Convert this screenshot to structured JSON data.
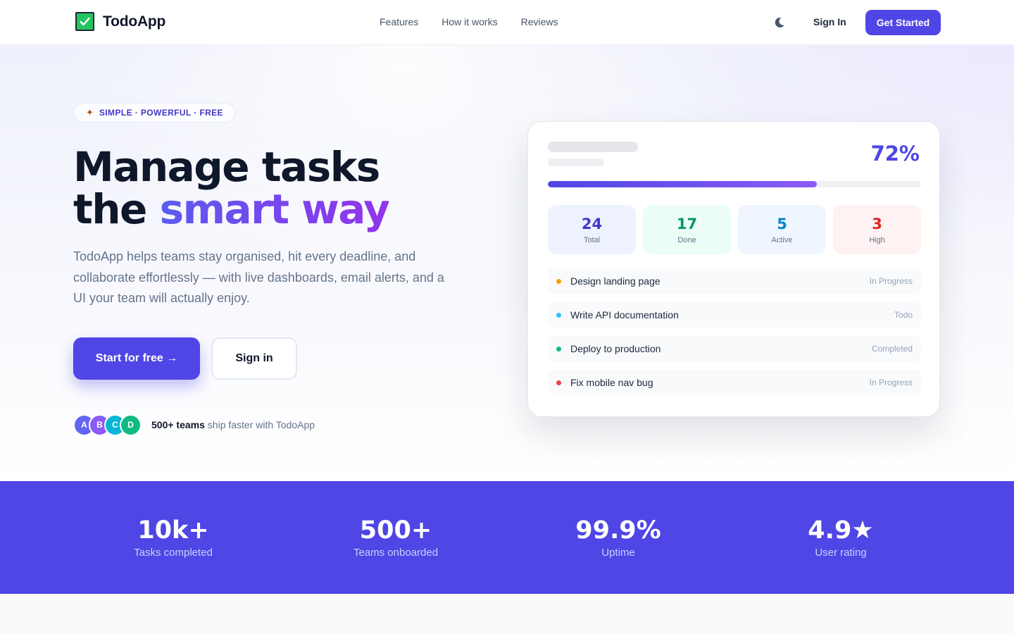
{
  "nav": {
    "brand": "TodoApp",
    "links": [
      "Features",
      "How it works",
      "Reviews"
    ],
    "theme_icon": "moon-icon",
    "sign_in": "Sign In",
    "get_started": "Get Started"
  },
  "hero": {
    "badge_icon": "sparkle-icon",
    "badge": "SIMPLE · POWERFUL · FREE",
    "headline_line1": "Manage tasks",
    "headline_word": "the",
    "headline_gradient": "smart way",
    "subtext": "TodoApp helps teams stay organised, hit every deadline, and collaborate effortlessly — with live dashboards, email alerts, and a UI your team will actually enjoy.",
    "primary_cta": "Start for free →",
    "secondary_cta": "Sign in",
    "avatars": [
      "A",
      "B",
      "C",
      "D"
    ],
    "social_bold": "500+ teams",
    "social_rest": " ship faster with TodoApp"
  },
  "dashboard": {
    "percent": "72%",
    "progress": 0.72,
    "stats": [
      {
        "value": "24",
        "label": "Total"
      },
      {
        "value": "17",
        "label": "Done"
      },
      {
        "value": "5",
        "label": "Active"
      },
      {
        "value": "3",
        "label": "High"
      }
    ],
    "tasks": [
      {
        "title": "Design landing page",
        "status": "In Progress"
      },
      {
        "title": "Write API documentation",
        "status": "Todo"
      },
      {
        "title": "Deploy to production",
        "status": "Completed"
      },
      {
        "title": "Fix mobile nav bug",
        "status": "In Progress"
      }
    ]
  },
  "metrics": [
    {
      "value": "10k+",
      "label": "Tasks completed"
    },
    {
      "value": "500+",
      "label": "Teams onboarded"
    },
    {
      "value": "99.9%",
      "label": "Uptime"
    },
    {
      "value": "4.9★",
      "label": "User rating"
    }
  ],
  "colors": {
    "brand": "#4f46e5",
    "gradient_end": "#9333ea",
    "logo_check": "#22c55e"
  }
}
